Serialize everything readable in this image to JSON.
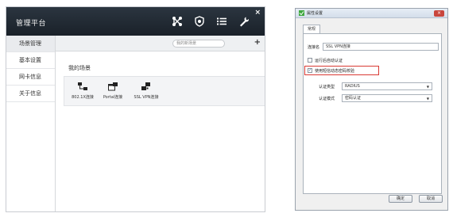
{
  "left_window": {
    "title": "管理平台",
    "close_symbol": "×",
    "toolbar_icons": [
      "network-icon",
      "shield-icon",
      "list-icon",
      "wrench-icon"
    ],
    "sidebar": {
      "items": [
        {
          "label": "场景管理",
          "active": true
        },
        {
          "label": "基本设置",
          "active": false
        },
        {
          "label": "网卡信息",
          "active": false
        },
        {
          "label": "关于信息",
          "active": false
        }
      ]
    },
    "main": {
      "search_placeholder": "我的新场景",
      "add_symbol": "+",
      "section_title": "我的场景",
      "scenes": [
        {
          "label": "802.1X连接",
          "icon": "pc-network-icon"
        },
        {
          "label": "Portal连接",
          "icon": "portal-window-icon"
        },
        {
          "label": "SSL VPN连接",
          "icon": "vpn-network-icon"
        }
      ]
    }
  },
  "dialog": {
    "title": "属性设置",
    "close_symbol": "×",
    "tab": "常规",
    "connection_name_label": "连接名",
    "connection_name_value": "SSL VPN连接",
    "auto_auth_label": "运行后自动认证",
    "auto_auth_checked": false,
    "sms_otp_label": "使用短信动态密码校验",
    "sms_otp_checked": true,
    "auth_type_label": "认证类型",
    "auth_type_value": "RADIUS",
    "auth_mode_label": "认证模式",
    "auth_mode_value": "密码认证",
    "ok_label": "确定",
    "cancel_label": "取消"
  },
  "colors": {
    "titlebar": "#1f2830",
    "highlight": "#d93a34"
  }
}
